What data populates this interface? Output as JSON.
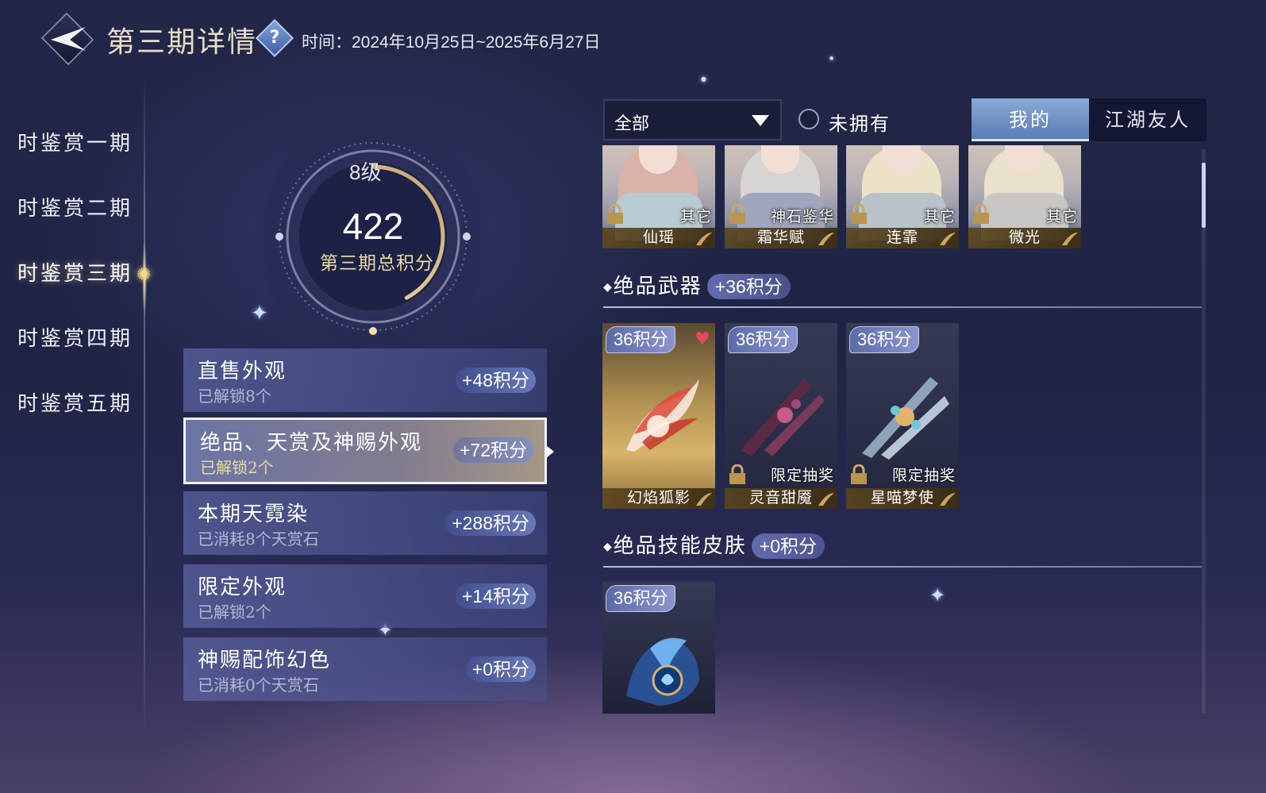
{
  "header": {
    "title": "第三期详情",
    "help_symbol": "?",
    "time_text": "时间：2024年10月25日~2025年6月27日"
  },
  "nav": {
    "items": [
      {
        "label": "时鉴赏一期"
      },
      {
        "label": "时鉴赏二期"
      },
      {
        "label": "时鉴赏三期"
      },
      {
        "label": "时鉴赏四期"
      },
      {
        "label": "时鉴赏五期"
      }
    ],
    "active_index": 2
  },
  "score": {
    "level": "8级",
    "value": "422",
    "label": "第三期总积分",
    "ring_progress": 0.42
  },
  "categories": [
    {
      "title": "直售外观",
      "sub": "已解锁8个",
      "points": "+48积分"
    },
    {
      "title": "绝品、天赏及神赐外观",
      "sub": "已解锁2个",
      "points": "+72积分"
    },
    {
      "title": "本期天霓染",
      "sub": "已消耗8个天赏石",
      "points": "+288积分"
    },
    {
      "title": "限定外观",
      "sub": "已解锁2个",
      "points": "+14积分"
    },
    {
      "title": "神赐配饰幻色",
      "sub": "已消耗0个天赏石",
      "points": "+0积分"
    }
  ],
  "filters": {
    "dropdown_selected": "全部",
    "checkbox_label": "未拥有",
    "checkbox_checked": false,
    "tabs": [
      "我的",
      "江湖友人"
    ],
    "active_tab": 0
  },
  "characters": [
    {
      "tag": "其它",
      "name": "仙瑶",
      "hair": "#d9b2a8",
      "body": "#b9cbd2"
    },
    {
      "tag": "神石鉴华",
      "name": "霜华赋",
      "hair": "#d7d4d2",
      "body": "#9fa6bb"
    },
    {
      "tag": "其它",
      "name": "连霏",
      "hair": "#ece2c7",
      "body": "#b7c3c9"
    },
    {
      "tag": "其它",
      "name": "微光",
      "hair": "#e9e1c9",
      "body": "#c9c7c6"
    }
  ],
  "weapons_section": {
    "title": "绝品武器",
    "points": "+36积分",
    "items": [
      {
        "badge": "36积分",
        "tag": "",
        "name": "幻焰狐影",
        "favorite": true,
        "locked": false
      },
      {
        "badge": "36积分",
        "tag": "限定抽奖",
        "name": "灵音甜魇",
        "favorite": false,
        "locked": true
      },
      {
        "badge": "36积分",
        "tag": "限定抽奖",
        "name": "星喵梦使",
        "favorite": false,
        "locked": true
      }
    ]
  },
  "skills_section": {
    "title": "绝品技能皮肤",
    "points": "+0积分",
    "items": [
      {
        "badge": "36积分"
      }
    ]
  },
  "icons": {
    "back": "back-arrow-icon",
    "help": "question-diamond-icon",
    "lock": "lock-icon",
    "heart": "heart-icon",
    "dropdown": "triangle-down-icon"
  },
  "colors": {
    "gold_text": "#ecd9a8",
    "points_pill": "#7e89c9",
    "heart": "#e84763"
  }
}
